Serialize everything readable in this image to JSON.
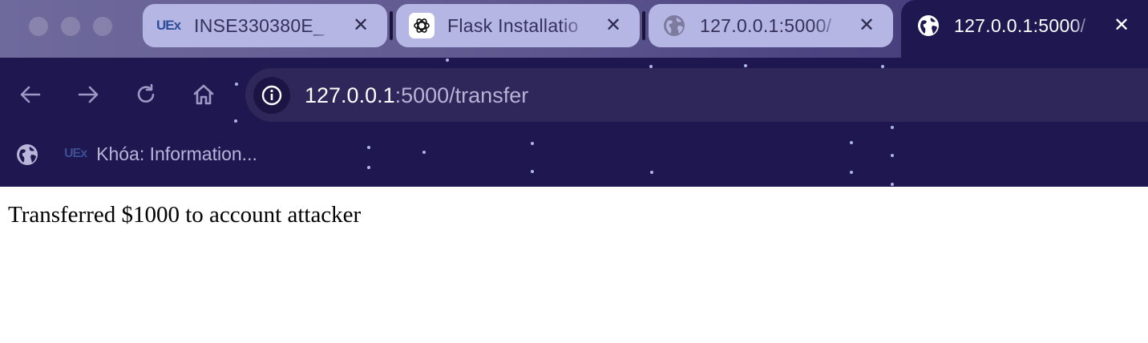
{
  "window": {
    "traffic_lights": [
      "close",
      "minimize",
      "maximize"
    ]
  },
  "tabs": [
    {
      "title": "INSE330380E_",
      "favicon": "uex-logo",
      "favicon_text": "UEx",
      "close": "✕",
      "active": false
    },
    {
      "title": "Flask Installatio",
      "favicon": "openai-icon",
      "close": "✕",
      "active": false
    },
    {
      "title": "127.0.0.1:5000/",
      "favicon": "globe-icon",
      "close": "✕",
      "active": false
    },
    {
      "title": "127.0.0.1:5000/",
      "favicon": "globe-icon",
      "close": "✕",
      "active": true
    }
  ],
  "toolbar": {
    "back_icon": "arrow-left-icon",
    "forward_icon": "arrow-right-icon",
    "reload_icon": "reload-icon",
    "home_icon": "home-icon",
    "site_info_icon": "info-icon",
    "url_host": "127.0.0.1",
    "url_rest": ":5000/transfer"
  },
  "bookmarks": {
    "globe_icon": "globe-icon",
    "items": [
      {
        "logo_text": "UEx",
        "label": "Khóa: Information..."
      }
    ]
  },
  "page": {
    "message": "Transferred $1000 to account attacker"
  },
  "colors": {
    "chrome_bg": "#1f1750",
    "inactive_tab": "#b5b6e3",
    "address_bar": "#2f2659",
    "url_path": "#b7b2d6"
  }
}
